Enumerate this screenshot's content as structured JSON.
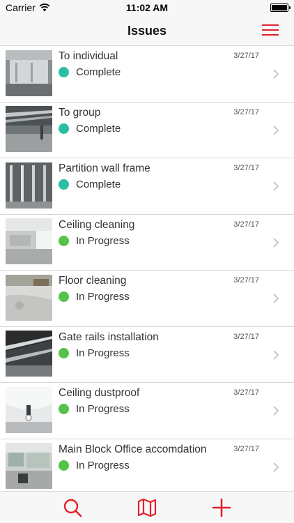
{
  "status_bar": {
    "carrier": "Carrier",
    "time": "11:02 AM",
    "battery_level": 1.0
  },
  "nav": {
    "title": "Issues"
  },
  "colors": {
    "accent": "#e0212c",
    "complete": "#2bbf9f",
    "in_progress": "#55c24a"
  },
  "issues": [
    {
      "title": "To individual",
      "status": "Complete",
      "date": "3/27/17",
      "status_color": "#2bbf9f"
    },
    {
      "title": "To group",
      "status": "Complete",
      "date": "3/27/17",
      "status_color": "#2bbf9f"
    },
    {
      "title": "Partition wall frame",
      "status": "Complete",
      "date": "3/27/17",
      "status_color": "#2bbf9f"
    },
    {
      "title": "Ceiling cleaning",
      "status": "In Progress",
      "date": "3/27/17",
      "status_color": "#55c24a"
    },
    {
      "title": "Floor cleaning",
      "status": "In Progress",
      "date": "3/27/17",
      "status_color": "#55c24a"
    },
    {
      "title": "Gate rails installation",
      "status": "In Progress",
      "date": "3/27/17",
      "status_color": "#55c24a"
    },
    {
      "title": "Ceiling dustproof",
      "status": "In Progress",
      "date": "3/27/17",
      "status_color": "#55c24a"
    },
    {
      "title": "Main Block Office accomdation",
      "status": "In Progress",
      "date": "3/27/17",
      "status_color": "#55c24a"
    }
  ],
  "tab_bar": {
    "icons": [
      "search-icon",
      "map-icon",
      "plus-icon"
    ]
  }
}
